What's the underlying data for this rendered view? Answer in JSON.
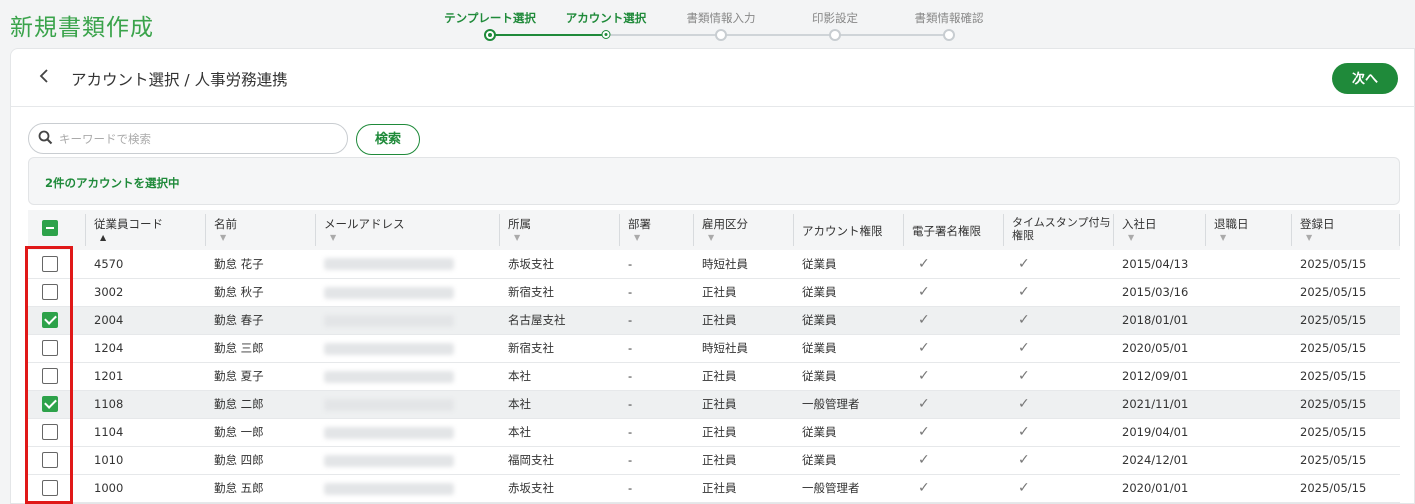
{
  "page_title": "新規書類作成",
  "steps": [
    {
      "label": "テンプレート選択",
      "state": "done"
    },
    {
      "label": "アカウント選択",
      "state": "active"
    },
    {
      "label": "書類情報入力",
      "state": "todo"
    },
    {
      "label": "印影設定",
      "state": "todo"
    },
    {
      "label": "書類情報確認",
      "state": "todo"
    }
  ],
  "header": {
    "back_icon": "chevron-left-icon",
    "title": "アカウント選択 / 人事労務連携",
    "next_label": "次へ"
  },
  "search": {
    "placeholder": "キーワードで検索",
    "value": "",
    "button_label": "検索"
  },
  "selection_status": "2件のアカウントを選択中",
  "columns": [
    "従業員コード",
    "名前",
    "メールアドレス",
    "所属",
    "部署",
    "雇用区分",
    "アカウント権限",
    "電子署名権限",
    "タイムスタンプ付与権限",
    "入社日",
    "退職日",
    "登録日"
  ],
  "rows": [
    {
      "checked": false,
      "code": "4570",
      "name": "勤怠 花子",
      "org": "赤坂支社",
      "dept": "-",
      "type": "時短社員",
      "role": "従業員",
      "joined": "2015/04/13",
      "retired": "",
      "registered": "2025/05/15"
    },
    {
      "checked": false,
      "code": "3002",
      "name": "勤怠 秋子",
      "org": "新宿支社",
      "dept": "-",
      "type": "正社員",
      "role": "従業員",
      "joined": "2015/03/16",
      "retired": "",
      "registered": "2025/05/15"
    },
    {
      "checked": true,
      "code": "2004",
      "name": "勤怠 春子",
      "org": "名古屋支社",
      "dept": "-",
      "type": "正社員",
      "role": "従業員",
      "joined": "2018/01/01",
      "retired": "",
      "registered": "2025/05/15"
    },
    {
      "checked": false,
      "code": "1204",
      "name": "勤怠 三郎",
      "org": "新宿支社",
      "dept": "-",
      "type": "時短社員",
      "role": "従業員",
      "joined": "2020/05/01",
      "retired": "",
      "registered": "2025/05/15"
    },
    {
      "checked": false,
      "code": "1201",
      "name": "勤怠 夏子",
      "org": "本社",
      "dept": "-",
      "type": "正社員",
      "role": "従業員",
      "joined": "2012/09/01",
      "retired": "",
      "registered": "2025/05/15"
    },
    {
      "checked": true,
      "code": "1108",
      "name": "勤怠 二郎",
      "org": "本社",
      "dept": "-",
      "type": "正社員",
      "role": "一般管理者",
      "joined": "2021/11/01",
      "retired": "",
      "registered": "2025/05/15"
    },
    {
      "checked": false,
      "code": "1104",
      "name": "勤怠 一郎",
      "org": "本社",
      "dept": "-",
      "type": "正社員",
      "role": "従業員",
      "joined": "2019/04/01",
      "retired": "",
      "registered": "2025/05/15"
    },
    {
      "checked": false,
      "code": "1010",
      "name": "勤怠 四郎",
      "org": "福岡支社",
      "dept": "-",
      "type": "正社員",
      "role": "従業員",
      "joined": "2024/12/01",
      "retired": "",
      "registered": "2025/05/15"
    },
    {
      "checked": false,
      "code": "1000",
      "name": "勤怠 五郎",
      "org": "赤坂支社",
      "dept": "-",
      "type": "正社員",
      "role": "一般管理者",
      "joined": "2020/01/01",
      "retired": "",
      "registered": "2025/05/15"
    }
  ],
  "colors": {
    "accent": "#1f8a3a",
    "checkbox_checked": "#2da24a",
    "highlight_border": "#e01818"
  }
}
